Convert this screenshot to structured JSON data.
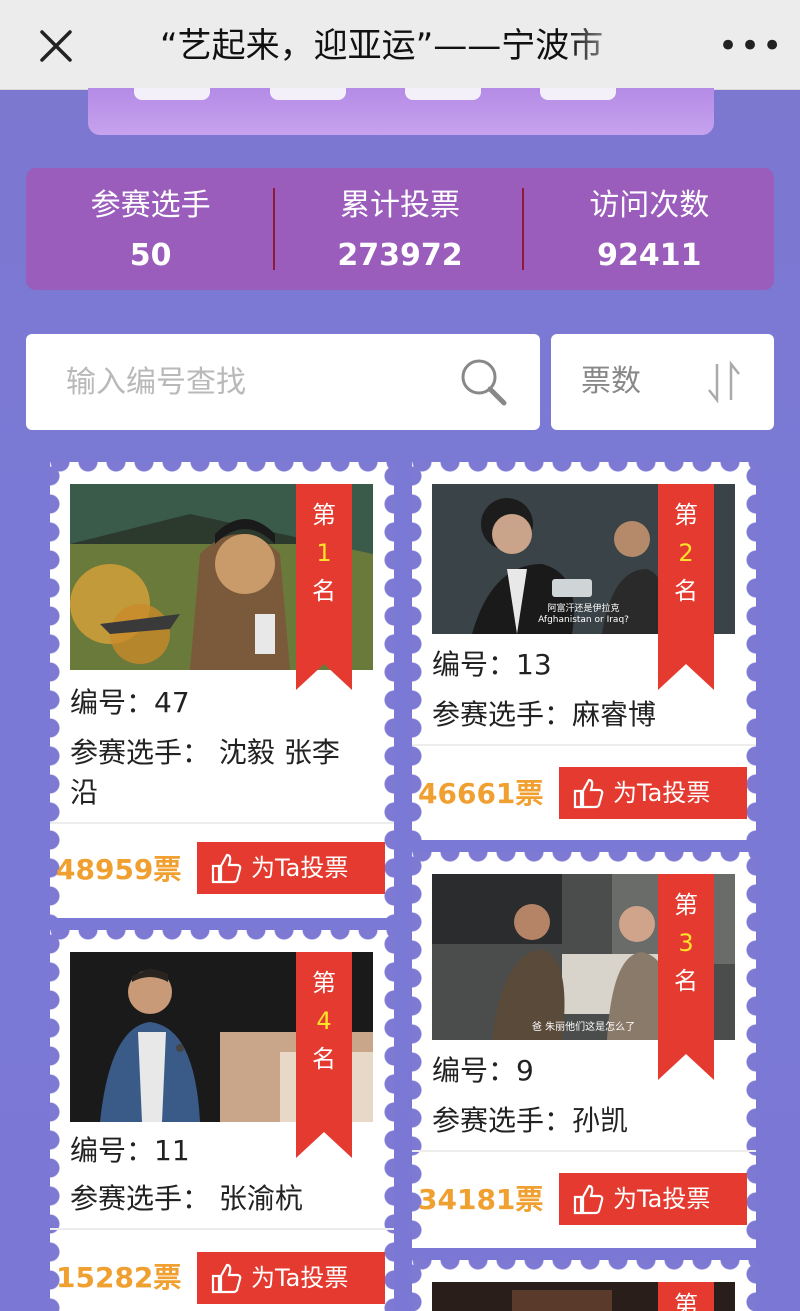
{
  "header": {
    "title": "“艺起来，迎亚运”——宁波市",
    "close_icon": "close-icon",
    "more_label": "•••"
  },
  "stats": [
    {
      "label": "参赛选手",
      "value": "50"
    },
    {
      "label": "累计投票",
      "value": "273972"
    },
    {
      "label": "访问次数",
      "value": "92411"
    }
  ],
  "search": {
    "placeholder": "输入编号查找",
    "sort_label": "票数"
  },
  "colors": {
    "accent_red": "#e53a2f",
    "stats_bg": "#9b5dbc",
    "votes_orange": "#f0a030",
    "rank_yellow": "#ffe32a"
  },
  "cards": [
    {
      "rank_prefix": "第",
      "rank": "1",
      "rank_suffix": "名",
      "id_label": "编号：",
      "id": "47",
      "contestant_label": "参赛选手：",
      "contestant_line1": "沈毅 张李",
      "contestant_line2": "沿",
      "votes": "48959票",
      "vote_button": "为Ta投票"
    },
    {
      "rank_prefix": "第",
      "rank": "2",
      "rank_suffix": "名",
      "id_label": "编号：",
      "id": "13",
      "contestant_label": "参赛选手：",
      "contestant": "麻睿博",
      "votes": "46661票",
      "vote_button": "为Ta投票",
      "subtitle_line1": "阿富汗还是伊拉克",
      "subtitle_line2": "Afghanistan or Iraq?"
    },
    {
      "rank_prefix": "第",
      "rank": "3",
      "rank_suffix": "名",
      "id_label": "编号：",
      "id": "9",
      "contestant_label": "参赛选手：",
      "contestant": "孙凯",
      "votes": "34181票",
      "vote_button": "为Ta投票",
      "subtitle_line1": "爸 朱丽他们这是怎么了"
    },
    {
      "rank_prefix": "第",
      "rank": "4",
      "rank_suffix": "名",
      "id_label": "编号：",
      "id": "11",
      "contestant_label": "参赛选手：",
      "contestant": "张渝杭",
      "votes": "15282票",
      "vote_button": "为Ta投票"
    },
    {
      "rank_prefix": "第"
    }
  ]
}
